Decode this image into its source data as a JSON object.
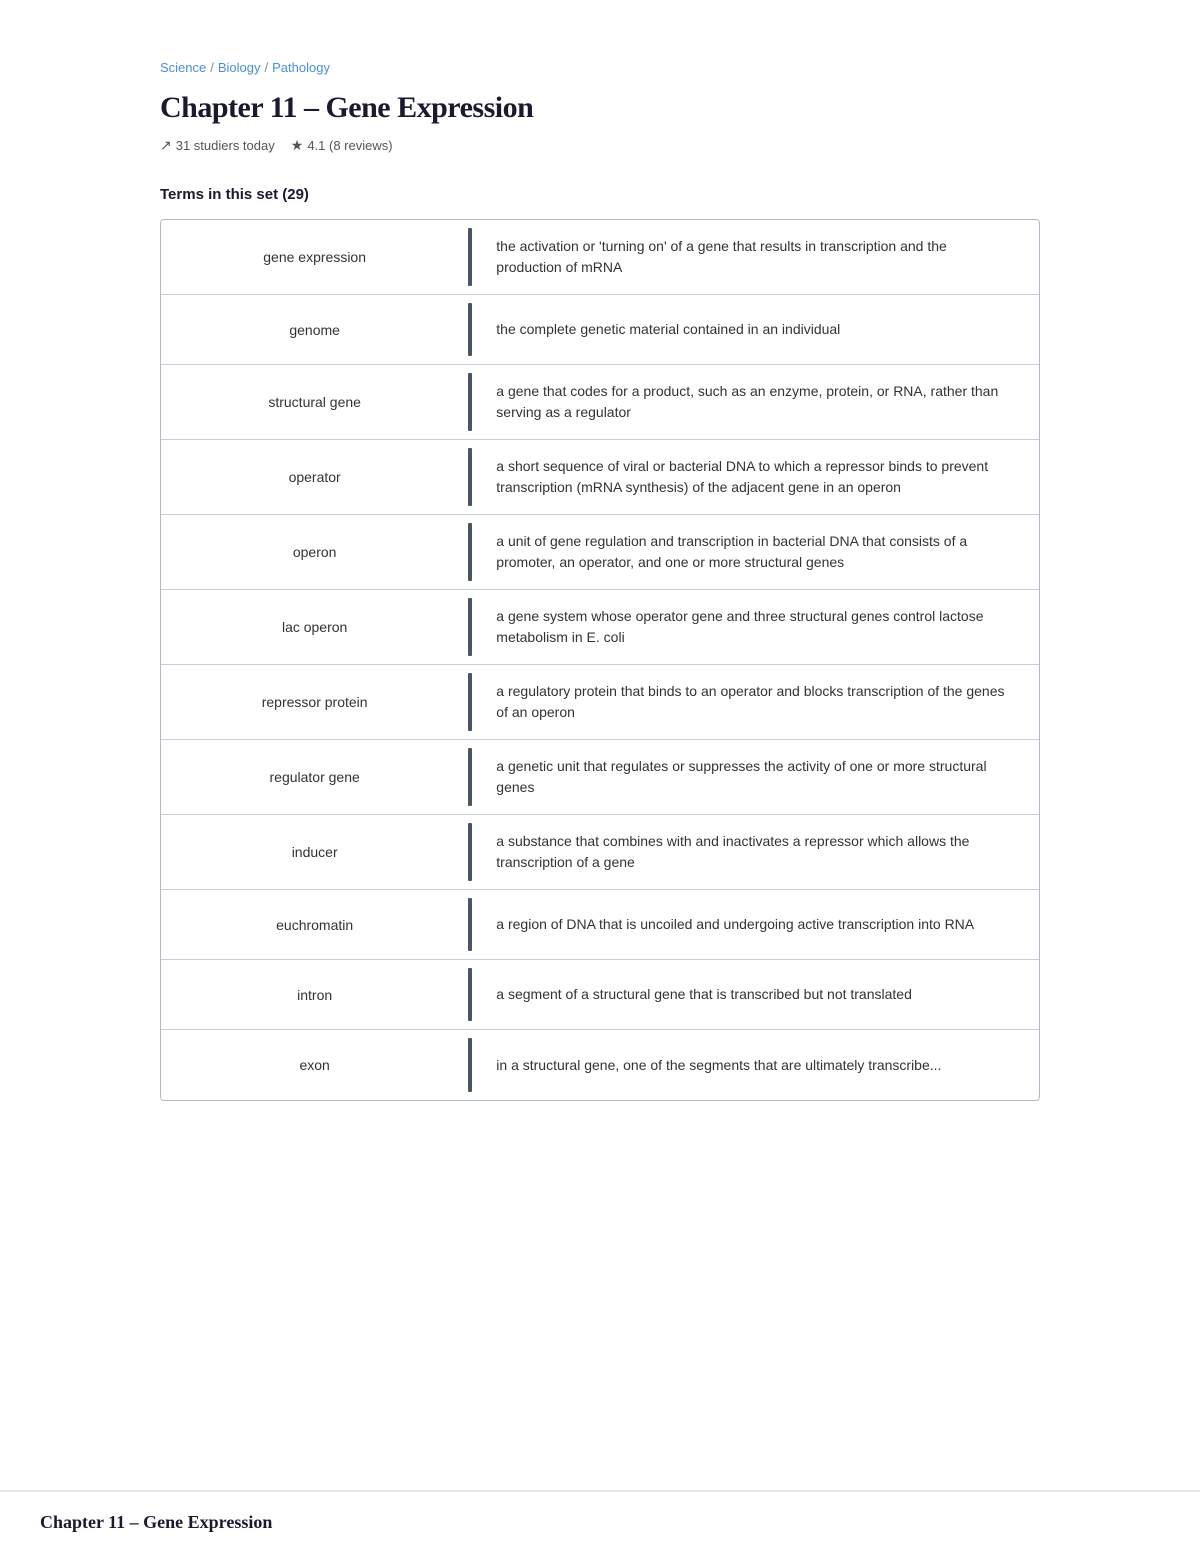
{
  "breadcrumb": {
    "items": [
      "Science",
      "Biology",
      "Pathology"
    ]
  },
  "page": {
    "title": "Chapter 11 – Gene Expression",
    "studiers": "31 studiers today",
    "rating": "4.1 (8 reviews)",
    "section_label": "Terms in this set (29)"
  },
  "terms": [
    {
      "term": "gene expression",
      "definition": "the activation or 'turning on' of a gene that results in transcription and the production of mRNA"
    },
    {
      "term": "genome",
      "definition": "the complete genetic material contained in an individual"
    },
    {
      "term": "structural gene",
      "definition": "a gene that codes for a product, such as an enzyme, protein, or RNA, rather than serving as a regulator"
    },
    {
      "term": "operator",
      "definition": "a short sequence of viral or bacterial DNA to which a repressor binds to prevent transcription (mRNA synthesis) of the adjacent gene in an operon"
    },
    {
      "term": "operon",
      "definition": "a unit of gene regulation and transcription in bacterial DNA that consists of a promoter, an operator, and one or more structural genes"
    },
    {
      "term": "lac operon",
      "definition": "a gene system whose operator gene and three structural genes control lactose metabolism in E. coli"
    },
    {
      "term": "repressor protein",
      "definition": "a regulatory protein that binds to an operator and blocks transcription of the genes of an operon"
    },
    {
      "term": "regulator gene",
      "definition": "a genetic unit that regulates or suppresses the activity of one or more structural genes"
    },
    {
      "term": "inducer",
      "definition": "a substance that combines with and inactivates a repressor which allows the transcription of a gene"
    },
    {
      "term": "euchromatin",
      "definition": "a region of DNA that is uncoiled and undergoing active transcription into RNA"
    },
    {
      "term": "intron",
      "definition": "a segment of a structural gene that is transcribed but not translated"
    },
    {
      "term": "exon",
      "definition": "in a structural gene, one of the segments that are ultimately transcribe..."
    }
  ],
  "footer": {
    "title": "Chapter 11 – Gene Expression"
  },
  "icons": {
    "trending": "↗",
    "star": "★",
    "separator": "/"
  }
}
